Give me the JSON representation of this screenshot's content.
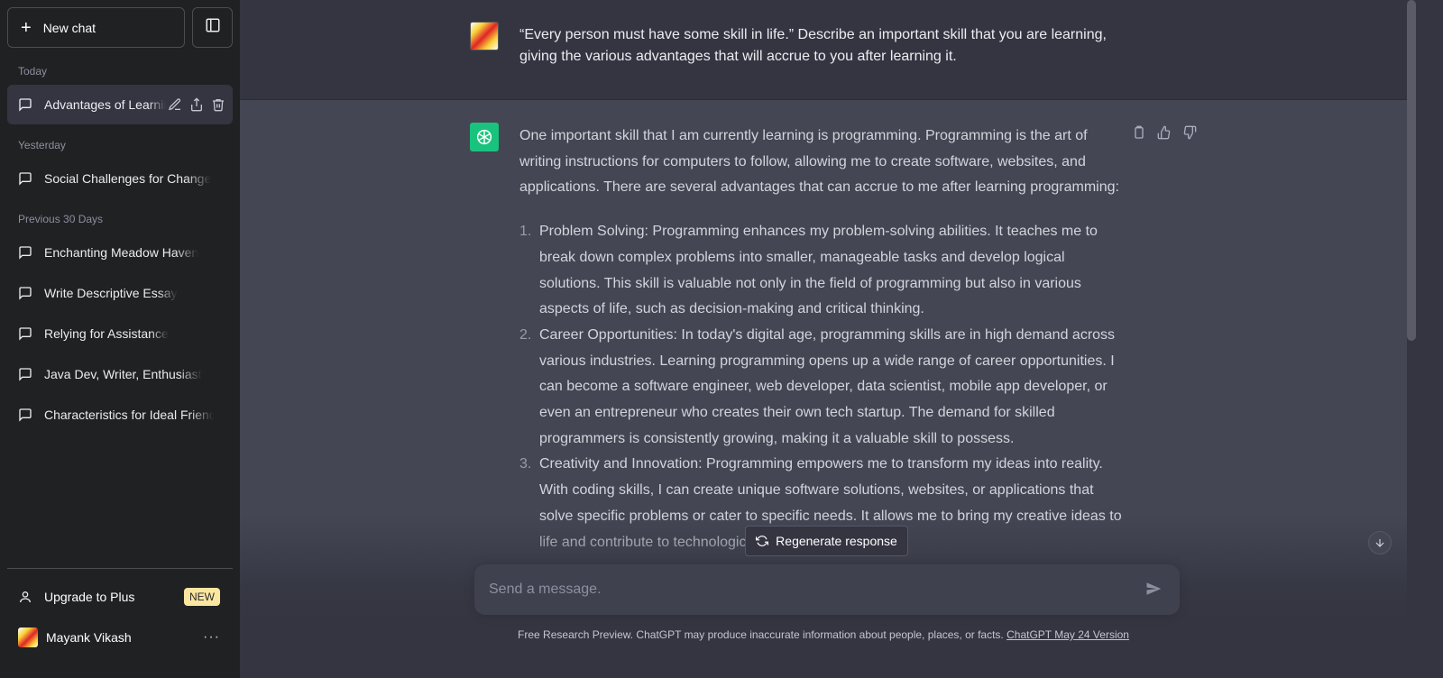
{
  "sidebar": {
    "new_chat_label": "New chat",
    "groups": {
      "today": "Today",
      "yesterday": "Yesterday",
      "previous_30": "Previous 30 Days"
    },
    "chats": [
      {
        "label": "Advantages of Learning Programming",
        "active": true
      },
      {
        "label": "Social Challenges for Change"
      },
      {
        "label": "Enchanting Meadow Haven"
      },
      {
        "label": "Write Descriptive Essay"
      },
      {
        "label": "Relying for Assistance"
      },
      {
        "label": "Java Dev, Writer, Enthusiast"
      },
      {
        "label": "Characteristics for Ideal Friend"
      }
    ],
    "upgrade_label": "Upgrade to Plus",
    "upgrade_badge": "NEW",
    "user_name": "Mayank Vikash",
    "more_glyph": "···"
  },
  "conversation": {
    "user_message": "“Every person must have some skill in life.” Describe an important skill that you are learning, giving the various advantages that will accrue to you after learning it.",
    "assistant_intro": "One important skill that I am currently learning is programming. Programming is the art of writing instructions for computers to follow, allowing me to create software, websites, and applications. There are several advantages that can accrue to me after learning programming:",
    "points": [
      {
        "num": "1.",
        "text": "Problem Solving: Programming enhances my problem-solving abilities. It teaches me to break down complex problems into smaller, manageable tasks and develop logical solutions. This skill is valuable not only in the field of programming but also in various aspects of life, such as decision-making and critical thinking."
      },
      {
        "num": "2.",
        "text": "Career Opportunities: In today's digital age, programming skills are in high demand across various industries. Learning programming opens up a wide range of career opportunities. I can become a software engineer, web developer, data scientist, mobile app developer, or even an entrepreneur who creates their own tech startup. The demand for skilled programmers is consistently growing, making it a valuable skill to possess."
      },
      {
        "num": "3.",
        "text": "Creativity and Innovation: Programming empowers me to transform my ideas into reality. With coding skills, I can create unique software solutions, websites, or applications that solve specific problems or cater to specific needs. It allows me to bring my creative ideas to life and contribute to technological advancements."
      }
    ]
  },
  "regenerate_label": "Regenerate response",
  "composer": {
    "placeholder": "Send a message."
  },
  "footer": {
    "note": "Free Research Preview. ChatGPT may produce inaccurate information about people, places, or facts.",
    "version_link": "ChatGPT May 24 Version"
  },
  "colors": {
    "sidebar_bg": "#202123",
    "main_bg": "#343541",
    "assistant_bg": "#444654",
    "gpt_green": "#19c37d",
    "badge_yellow": "#fae69e"
  },
  "icons": [
    "plus-icon",
    "sidebar-toggle-icon",
    "chat-bubble-icon",
    "edit-icon",
    "share-icon",
    "trash-icon",
    "user-icon",
    "copy-icon",
    "thumbs-up-icon",
    "thumbs-down-icon",
    "refresh-icon",
    "send-icon",
    "arrow-down-icon",
    "openai-logo-icon"
  ]
}
